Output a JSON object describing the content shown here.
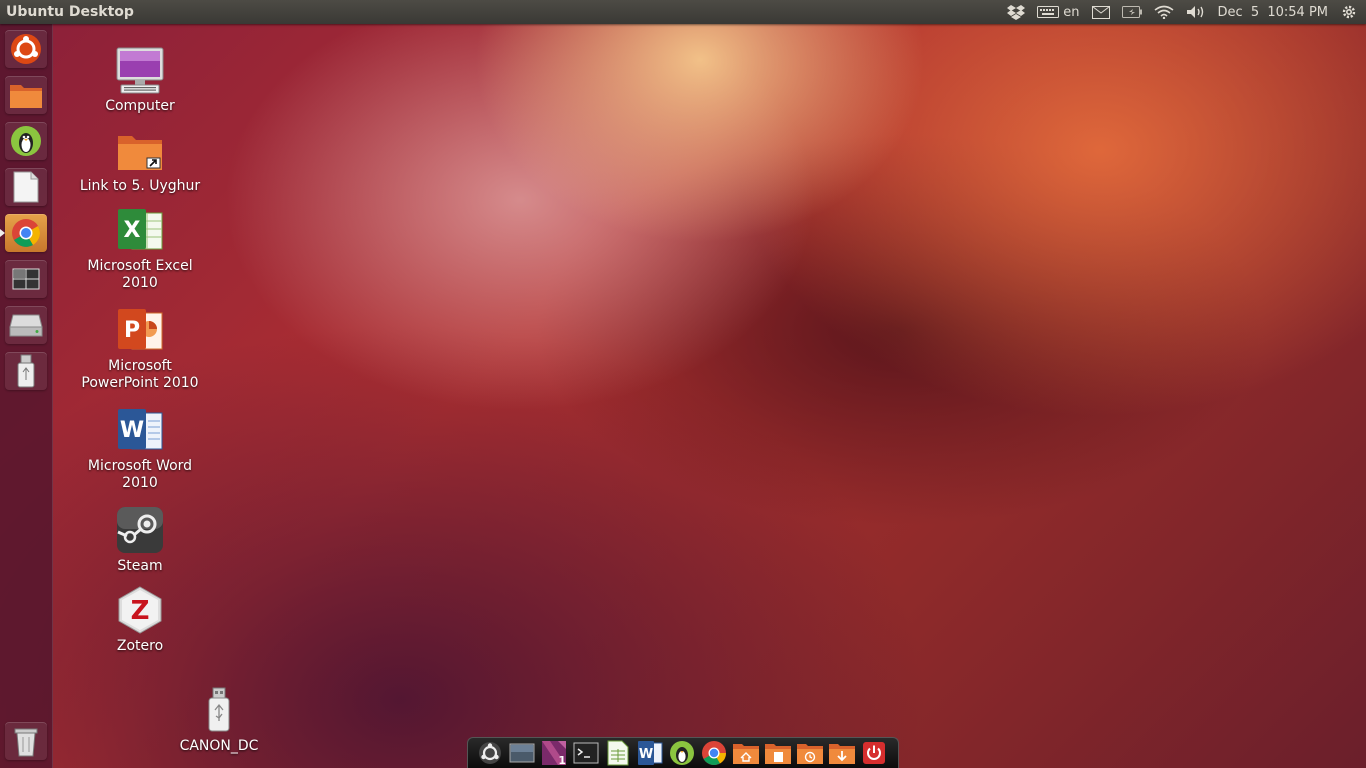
{
  "top_panel": {
    "title": "Ubuntu Desktop",
    "keyboard_layout": "en",
    "date": "Dec  5",
    "time": "10:54 PM"
  },
  "launcher": {
    "items": [
      {
        "name": "dash-home",
        "icon": "ubuntu-logo-icon"
      },
      {
        "name": "files",
        "icon": "folder-icon"
      },
      {
        "name": "linux-penguin-app",
        "icon": "penguin-icon"
      },
      {
        "name": "libreoffice",
        "icon": "document-icon"
      },
      {
        "name": "chrome",
        "icon": "chrome-icon",
        "active": true
      },
      {
        "name": "workspace-switcher",
        "icon": "workspaces-icon"
      },
      {
        "name": "drive",
        "icon": "drive-icon"
      },
      {
        "name": "usb-drive",
        "icon": "usb-icon"
      },
      {
        "name": "trash",
        "icon": "trash-icon"
      }
    ]
  },
  "desktop": {
    "icons": [
      {
        "label": "Computer",
        "icon": "computer-icon"
      },
      {
        "label": "Link to 5. Uyghur",
        "icon": "folder-link-icon"
      },
      {
        "label": "Microsoft Excel 2010",
        "icon": "excel-icon"
      },
      {
        "label": "Microsoft PowerPoint 2010",
        "icon": "powerpoint-icon"
      },
      {
        "label": "Microsoft Word 2010",
        "icon": "word-icon"
      },
      {
        "label": "Steam",
        "icon": "steam-icon"
      },
      {
        "label": "Zotero",
        "icon": "zotero-icon"
      },
      {
        "label": "CANON_DC",
        "icon": "usb-drive-icon"
      }
    ]
  },
  "dock": {
    "items": [
      {
        "icon": "ubuntu-logo-icon"
      },
      {
        "icon": "show-desktop-icon"
      },
      {
        "icon": "app-launcher-icon",
        "badge": "1"
      },
      {
        "icon": "terminal-icon"
      },
      {
        "icon": "spreadsheet-icon"
      },
      {
        "icon": "word-icon"
      },
      {
        "icon": "penguin-icon"
      },
      {
        "icon": "chrome-icon"
      },
      {
        "icon": "home-folder-icon"
      },
      {
        "icon": "documents-folder-icon"
      },
      {
        "icon": "recent-folder-icon"
      },
      {
        "icon": "downloads-folder-icon"
      },
      {
        "icon": "power-icon"
      }
    ]
  },
  "colors": {
    "panel": "#3c3b37",
    "launcher": "#50142d",
    "accent_orange": "#e07a2c",
    "chrome_active_tile": "#d8903a"
  }
}
